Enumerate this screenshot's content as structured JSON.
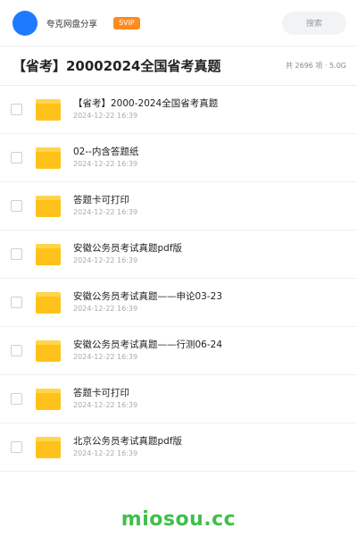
{
  "header": {
    "username": "夸克网盘分享",
    "vip_label": "SVIP",
    "search_label": "搜索",
    "avatar_color": "#1e7bff",
    "vip_color": "#ff8a1e"
  },
  "title_bar": {
    "title": "【省考】20002024全国省考真题",
    "meta": "共 2696 项 · 5.0G"
  },
  "files": [
    {
      "name": "【省考】2000-2024全国省考真题",
      "date": "2024-12-22 16:39",
      "icon": "folder-icon"
    },
    {
      "name": "02--内含答题纸",
      "date": "2024-12-22 16:39",
      "icon": "folder-icon"
    },
    {
      "name": "答题卡可打印",
      "date": "2024-12-22 16:39",
      "icon": "folder-icon"
    },
    {
      "name": "安徽公务员考试真题pdf版",
      "date": "2024-12-22 16:39",
      "icon": "folder-icon"
    },
    {
      "name": "安徽公务员考试真题——申论03-23",
      "date": "2024-12-22 16:39",
      "icon": "folder-icon"
    },
    {
      "name": "安徽公务员考试真题——行测06-24",
      "date": "2024-12-22 16:39",
      "icon": "folder-icon"
    },
    {
      "name": "答题卡可打印",
      "date": "2024-12-22 16:39",
      "icon": "folder-icon"
    },
    {
      "name": "北京公务员考试真题pdf版",
      "date": "2024-12-22 16:39",
      "icon": "folder-icon"
    }
  ],
  "watermark": {
    "text": "miosou.cc",
    "color": "#3fbf4a"
  }
}
